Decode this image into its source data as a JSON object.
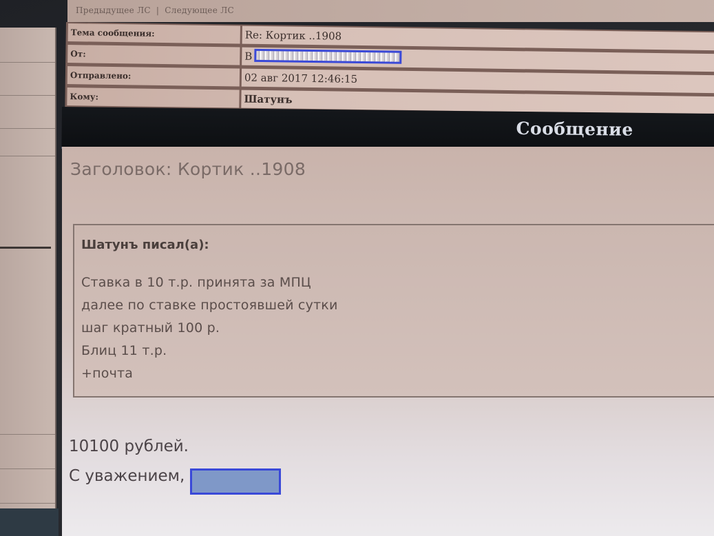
{
  "nav": {
    "prev_label": "Предыдущее ЛС",
    "separator": "|",
    "next_label": "Следующее ЛС"
  },
  "header": {
    "subject_label": "Тема сообщения:",
    "subject_value": "Re: Кортик ..1908",
    "from_label": "От:",
    "from_value": "В",
    "sent_label": "Отправлено:",
    "sent_value": "02 авг 2017 12:46:15",
    "to_label": "Кому:",
    "to_value": "Шатунъ"
  },
  "message": {
    "bar_title": "Сообщение",
    "subject_line": "Заголовок: Кортик ..1908",
    "quote": {
      "author": "Шатунъ писал(а):",
      "lines": [
        "Ставка в 10 т.р. принята за МПЦ",
        "далее по ставке простоявшей сутки",
        "шаг кратный 100 р.",
        "Блиц 11 т.р.",
        "+почта"
      ]
    },
    "reply_lines": [
      "10100 рублей.",
      "С уважением,"
    ]
  },
  "colors": {
    "redaction_border": "#3a49d8",
    "redaction_fill": "#7f98c8",
    "message_bar": "#0d0f12"
  }
}
